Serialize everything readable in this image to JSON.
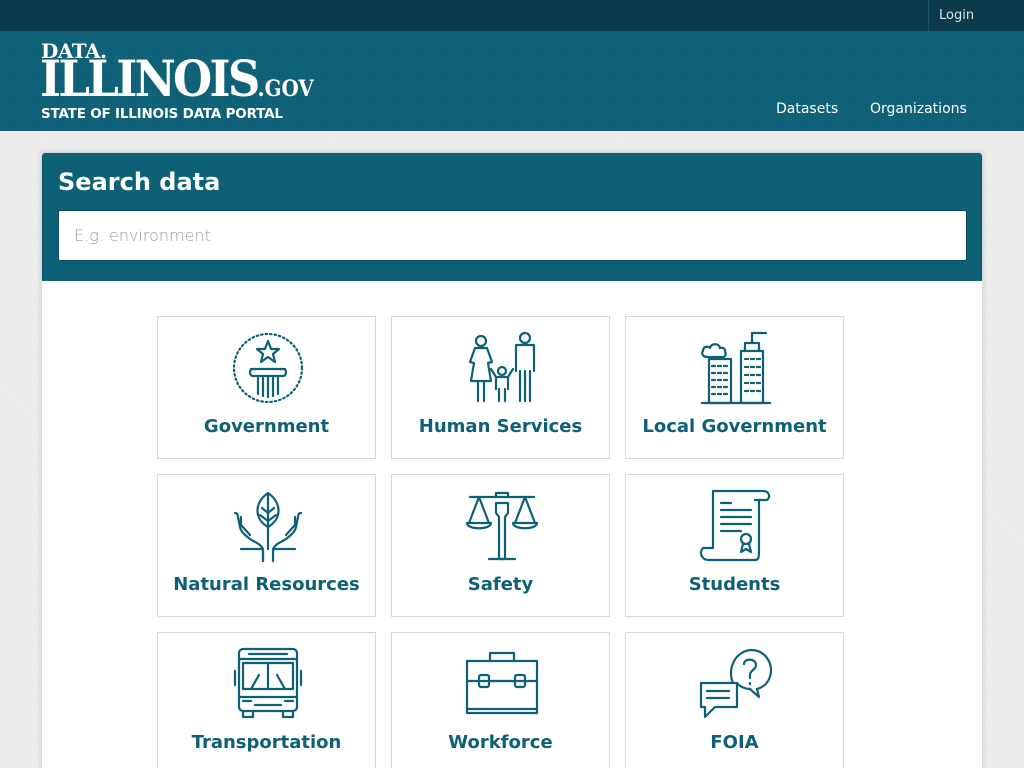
{
  "topbar": {
    "login_label": "Login"
  },
  "logo": {
    "line1": "DATA.",
    "line2": "ILLINOIS",
    "gov": ".GOV",
    "line3": "STATE OF ILLINOIS DATA PORTAL"
  },
  "nav": {
    "datasets": "Datasets",
    "organizations": "Organizations"
  },
  "search": {
    "title": "Search data",
    "placeholder": "E.g. environment"
  },
  "categories": [
    {
      "label": "Government",
      "icon": "government-icon"
    },
    {
      "label": "Human Services",
      "icon": "family-icon"
    },
    {
      "label": "Local Government",
      "icon": "city-buildings-icon"
    },
    {
      "label": "Natural Resources",
      "icon": "hands-leaf-icon"
    },
    {
      "label": "Safety",
      "icon": "justice-scale-icon"
    },
    {
      "label": "Students",
      "icon": "diploma-scroll-icon"
    },
    {
      "label": "Transportation",
      "icon": "bus-icon"
    },
    {
      "label": "Workforce",
      "icon": "briefcase-icon"
    },
    {
      "label": "FOIA",
      "icon": "question-chat-icon"
    }
  ]
}
